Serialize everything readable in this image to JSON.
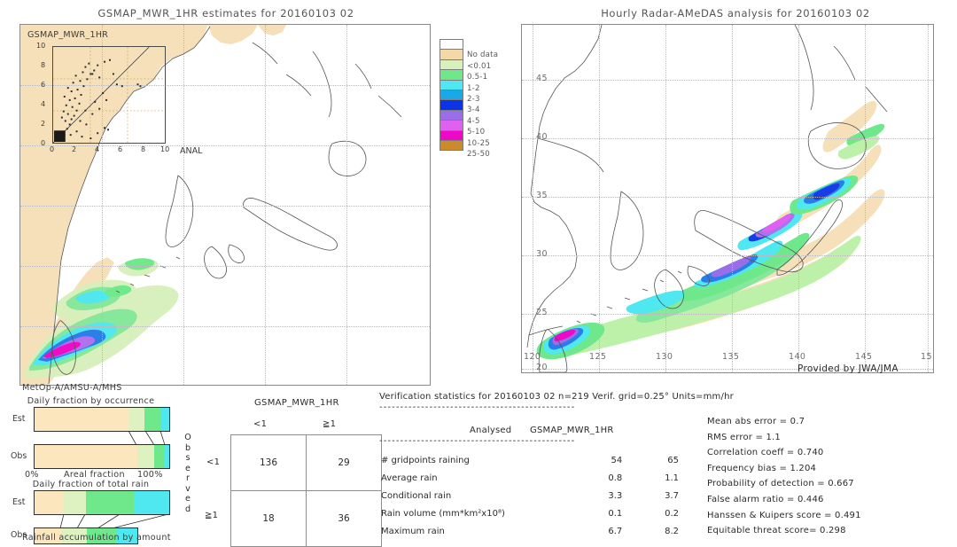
{
  "left_panel": {
    "title": "GSMAP_MWR_1HR estimates for 20160103 02",
    "inset_title": "GSMAP_MWR_1HR",
    "inset_xaxis_label": "ANAL",
    "inset_y_ticks": [
      "10",
      "8",
      "6",
      "4",
      "2",
      "0"
    ],
    "inset_x_ticks": [
      "0",
      "2",
      "4",
      "6",
      "8",
      "10"
    ]
  },
  "right_panel": {
    "title": "Hourly Radar-AMeDAS analysis for 20160103 02",
    "credit": "Provided by JWA/JMA",
    "lon_ticks": [
      "120",
      "125",
      "130",
      "135",
      "140",
      "145",
      "15"
    ],
    "lat_ticks": [
      "45",
      "40",
      "35",
      "30",
      "25",
      "20"
    ]
  },
  "colorbar": {
    "title": "",
    "entries": [
      {
        "label": "",
        "color": "#ffffff"
      },
      {
        "label": "No data",
        "color": "#f5d8a8"
      },
      {
        "label": "<0.01",
        "color": "#d8f0bc"
      },
      {
        "label": "0.5-1",
        "color": "#6ee88a"
      },
      {
        "label": "1-2",
        "color": "#4fe8f0"
      },
      {
        "label": "2-3",
        "color": "#1aa8e8"
      },
      {
        "label": "3-4",
        "color": "#0b34e8"
      },
      {
        "label": "4-5",
        "color": "#9a6ee8"
      },
      {
        "label": "5-10",
        "color": "#e060f0"
      },
      {
        "label": "10-25",
        "color": "#f008c8"
      },
      {
        "label": "25-50",
        "color": "#cc8a2a"
      }
    ]
  },
  "fraction_panels": {
    "sensor_label": "MetOp-A/AMSU-A/MHS",
    "occurrence": {
      "title": "Daily fraction by occurrence",
      "axis_left": "0%",
      "axis_center": "Areal fraction",
      "axis_right": "100%",
      "rows": [
        {
          "label": "Est",
          "segments": [
            {
              "color": "#fce6bd",
              "pct": 70.5
            },
            {
              "color": "#ddf2c0",
              "pct": 11.0
            },
            {
              "color": "#6ee88a",
              "pct": 12.5
            },
            {
              "color": "#4fe8f0",
              "pct": 6.0
            }
          ]
        },
        {
          "label": "Obs",
          "segments": [
            {
              "color": "#fce6bd",
              "pct": 76.0
            },
            {
              "color": "#ddf2c0",
              "pct": 13.0
            },
            {
              "color": "#6ee88a",
              "pct": 7.5
            },
            {
              "color": "#4fe8f0",
              "pct": 3.5
            }
          ]
        }
      ]
    },
    "total_rain": {
      "title": "Daily fraction of total rain",
      "caption": "Rainfall accumulation by amount",
      "rows": [
        {
          "label": "Est",
          "width_pct": 100,
          "segments": [
            {
              "color": "#fce6bd",
              "pct": 22.0
            },
            {
              "color": "#ddf2c0",
              "pct": 16.0
            },
            {
              "color": "#6ee88a",
              "pct": 36.0
            },
            {
              "color": "#4fe8f0",
              "pct": 26.0
            }
          ]
        },
        {
          "label": "Obs",
          "width_pct": 76,
          "segments": [
            {
              "color": "#fce6bd",
              "pct": 26.0
            },
            {
              "color": "#ddf2c0",
              "pct": 25.0
            },
            {
              "color": "#6ee88a",
              "pct": 28.0
            },
            {
              "color": "#4fe8f0",
              "pct": 21.0
            }
          ]
        }
      ]
    }
  },
  "contingency": {
    "column_group_label": "GSMAP_MWR_1HR",
    "column_headers": [
      "<1",
      "≧1"
    ],
    "row_axis_label": "Observed",
    "row_headers": [
      "<1",
      "≧1"
    ],
    "cells": [
      [
        "136",
        "29"
      ],
      [
        "18",
        "36"
      ]
    ]
  },
  "verification": {
    "header": "Verification statistics for 20160103 02  n=219  Verif. grid=0.25°  Units=mm/hr",
    "divider": "-----------------------------------------------",
    "col_headers": [
      "Analysed",
      "GSMAP_MWR_1HR"
    ],
    "rows": [
      {
        "label": "# gridpoints raining",
        "analysed": "54",
        "estimate": "65"
      },
      {
        "label": "Average rain",
        "analysed": "0.8",
        "estimate": "1.1"
      },
      {
        "label": "Conditional rain",
        "analysed": "3.3",
        "estimate": "3.7"
      },
      {
        "label": "Rain volume (mm*km²x10⁸)",
        "analysed": "0.1",
        "estimate": "0.2"
      },
      {
        "label": "Maximum rain",
        "analysed": "6.7",
        "estimate": "8.2"
      }
    ],
    "scores": [
      "Mean abs error = 0.7",
      "RMS error = 1.1",
      "Correlation coeff = 0.740",
      "Frequency bias = 1.204",
      "Probability of detection = 0.667",
      "False alarm ratio = 0.446",
      "Hanssen & Kuipers score = 0.491",
      "Equitable threat score= 0.298"
    ]
  }
}
